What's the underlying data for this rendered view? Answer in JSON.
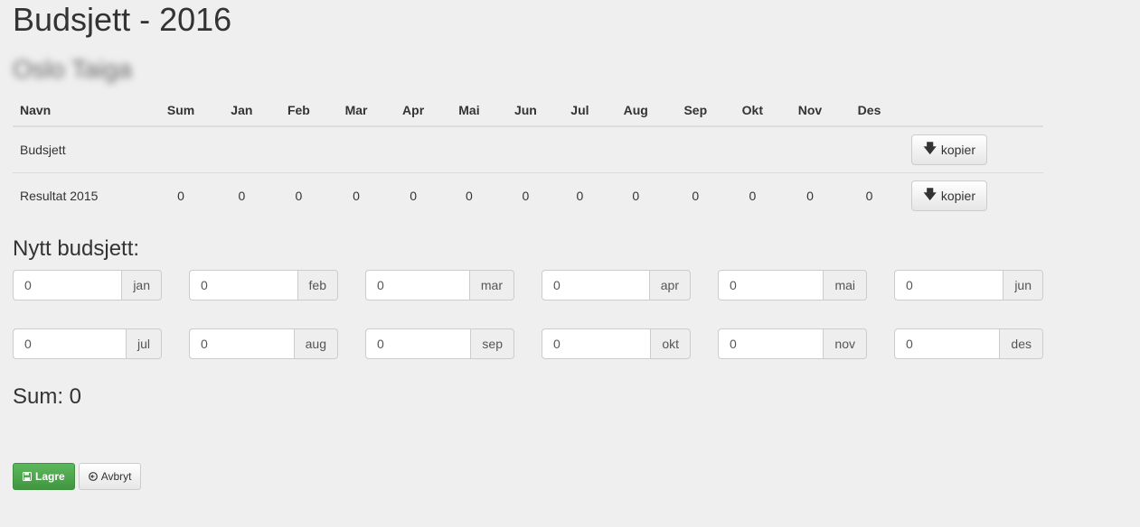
{
  "page": {
    "title": "Budsjett - 2016",
    "subtitle": "Oslo Taiga"
  },
  "table": {
    "headers": [
      "Navn",
      "Sum",
      "Jan",
      "Feb",
      "Mar",
      "Apr",
      "Mai",
      "Jun",
      "Jul",
      "Aug",
      "Sep",
      "Okt",
      "Nov",
      "Des"
    ],
    "rows": [
      {
        "name": "Budsjett",
        "values": [
          "",
          "",
          "",
          "",
          "",
          "",
          "",
          "",
          "",
          "",
          "",
          "",
          ""
        ],
        "action_label": "kopier"
      },
      {
        "name": "Resultat 2015",
        "values": [
          "0",
          "0",
          "0",
          "0",
          "0",
          "0",
          "0",
          "0",
          "0",
          "0",
          "0",
          "0",
          "0"
        ],
        "action_label": "kopier"
      }
    ]
  },
  "form": {
    "title": "Nytt budsjett:",
    "months": [
      {
        "value": "0",
        "label": "jan"
      },
      {
        "value": "0",
        "label": "feb"
      },
      {
        "value": "0",
        "label": "mar"
      },
      {
        "value": "0",
        "label": "apr"
      },
      {
        "value": "0",
        "label": "mai"
      },
      {
        "value": "0",
        "label": "jun"
      },
      {
        "value": "0",
        "label": "jul"
      },
      {
        "value": "0",
        "label": "aug"
      },
      {
        "value": "0",
        "label": "sep"
      },
      {
        "value": "0",
        "label": "okt"
      },
      {
        "value": "0",
        "label": "nov"
      },
      {
        "value": "0",
        "label": "des"
      }
    ],
    "sum_text": "Sum: 0"
  },
  "buttons": {
    "save_label": "Lagre",
    "cancel_label": "Avbryt",
    "save_icon": "floppy-disk-icon",
    "cancel_icon": "circle-arrow-left-icon",
    "copy_icon": "arrow-down-icon"
  },
  "colors": {
    "background": "#efefef",
    "save_button": "#4cae4c"
  }
}
